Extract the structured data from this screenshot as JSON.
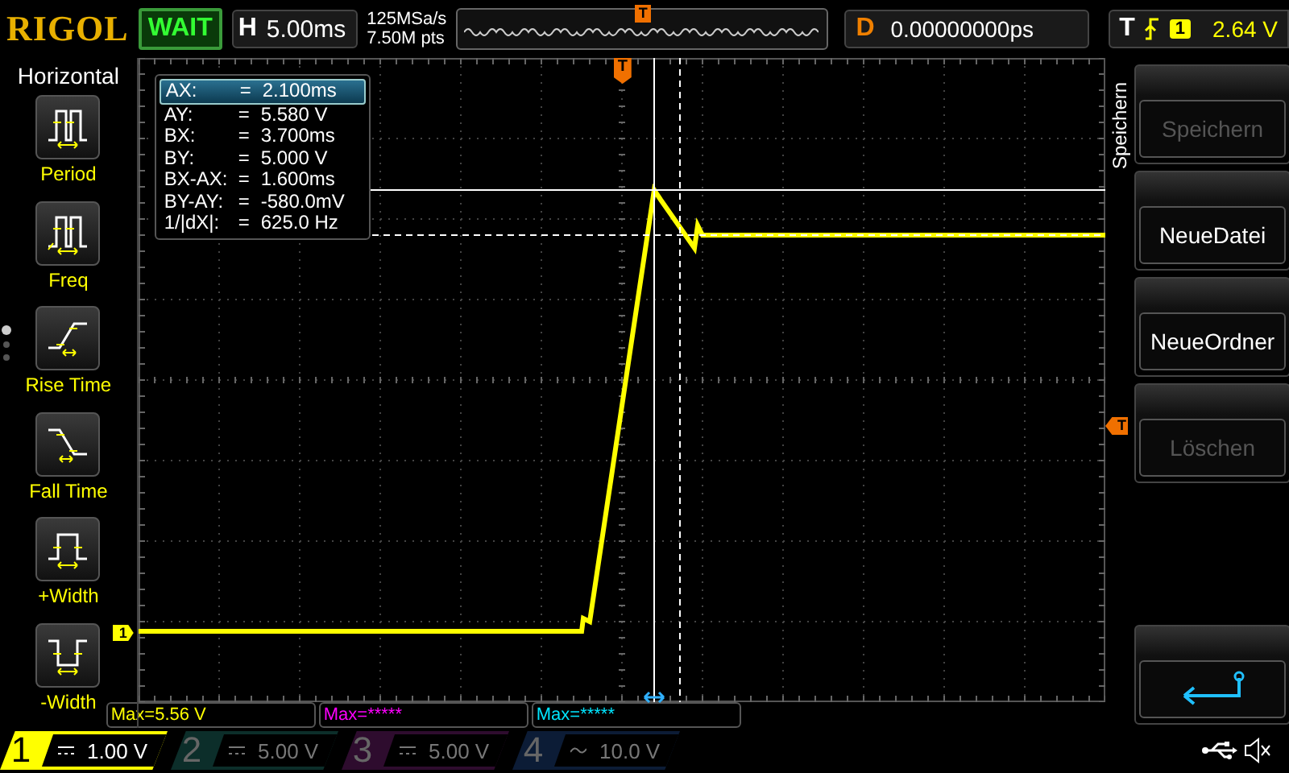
{
  "header": {
    "logo": "RIGOL",
    "run_state": "WAIT",
    "timebase": {
      "label": "H",
      "value": "5.00ms"
    },
    "sample_rate": "125MSa/s",
    "memory_depth": "7.50M pts",
    "overview_marker": "T",
    "delay": {
      "label": "D",
      "value": "0.00000000ps"
    },
    "trigger": {
      "label": "T",
      "source": "1",
      "level": "2.64 V"
    }
  },
  "left_menu": {
    "title": "Horizontal",
    "items": [
      {
        "label": "Period",
        "kind": "period"
      },
      {
        "label": "Freq",
        "kind": "freq"
      },
      {
        "label": "Rise Time",
        "kind": "rise"
      },
      {
        "label": "Fall Time",
        "kind": "fall"
      },
      {
        "label": "+Width",
        "kind": "pwidth"
      },
      {
        "label": "-Width",
        "kind": "nwidth"
      }
    ],
    "pages": [
      {
        "selected": true
      },
      {
        "selected": false
      },
      {
        "selected": false
      }
    ]
  },
  "screen": {
    "trigger_marker": "T",
    "channel_marker": "1",
    "trigger_level_marker": "T",
    "cursor_readout": [
      {
        "label": "AX:",
        "sign": "=",
        "value": "2.100ms",
        "selected": true
      },
      {
        "label": "AY:",
        "sign": "=",
        "value": "5.580 V",
        "selected": false
      },
      {
        "label": "BX:",
        "sign": "=",
        "value": "3.700ms",
        "selected": false
      },
      {
        "label": "BY:",
        "sign": "=",
        "value": "5.000 V",
        "selected": false
      },
      {
        "label": "BX-AX:",
        "sign": "=",
        "value": "1.600ms",
        "selected": false
      },
      {
        "label": "BY-AY:",
        "sign": "=",
        "value": "-580.0mV",
        "selected": false
      },
      {
        "label": "1/|dX|:",
        "sign": "=",
        "value": "625.0 Hz",
        "selected": false
      }
    ]
  },
  "right_menu": {
    "title": "Speichern",
    "items": [
      {
        "label": "Speichern",
        "disabled": true
      },
      {
        "label": "NeueDatei",
        "disabled": false
      },
      {
        "label": "NeueOrdner",
        "disabled": false
      },
      {
        "label": "Löschen",
        "disabled": true
      }
    ]
  },
  "measurements": [
    {
      "text": "Max=5.56 V",
      "color": "#ffff00"
    },
    {
      "text": "Max=*****",
      "color": "#ff00ff"
    },
    {
      "text": "Max=*****",
      "color": "#00e5ff"
    }
  ],
  "channels": [
    {
      "number": "1",
      "kind": "dc",
      "scale": "1.00 V",
      "on": true,
      "color": "#ffff00"
    },
    {
      "number": "2",
      "kind": "dc",
      "scale": "5.00 V",
      "on": false,
      "color": "#0c2e2a"
    },
    {
      "number": "3",
      "kind": "dc",
      "scale": "5.00 V",
      "on": false,
      "color": "#2e0c2e"
    },
    {
      "number": "4",
      "kind": "ac",
      "scale": "10.0 V",
      "on": false,
      "color": "#0c1c36"
    }
  ]
}
